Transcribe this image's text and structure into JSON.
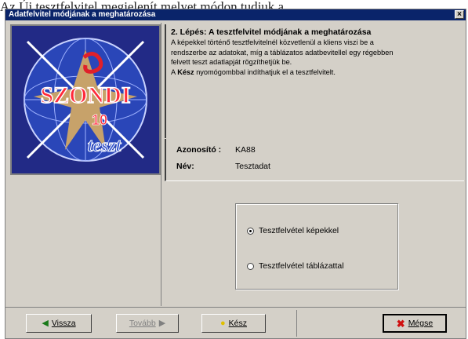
{
  "background_doc": {
    "fragment": "Az Új tesztfelvitel megjelenít melyet módon tudjuk a"
  },
  "window": {
    "title": "Adatfelvitel módjának a meghatározása",
    "close_glyph": "×"
  },
  "logo": {
    "line1": "SZONDI",
    "line2": "10",
    "line3": "teszt"
  },
  "instructions": {
    "step_title": "2. Lépés: A  tesztfelvitel módjának a meghatározása",
    "line1": "A képekkel történő tesztfelvitelnél közvetlenül a kliens viszi be a",
    "line2": "rendszerbe az adatokat, míg a táblázatos adatbevitellel egy régebben",
    "line3": "felvett teszt adatlapját rögzíthetjük be.",
    "line4_prefix": "A ",
    "line4_bold": "Kész",
    "line4_suffix": " nyomógombbal indíthatjuk el a tesztfelvitelt."
  },
  "info": {
    "id_label": "Azonosító :",
    "id_value": "KA88",
    "name_label": "Név:",
    "name_value": "Tesztadat"
  },
  "options": {
    "opt1": "Tesztfelvétel képekkel",
    "opt2": "Tesztfelvétel táblázattal",
    "selected": "opt1"
  },
  "buttons": {
    "back": "Vissza",
    "next": "Tovább",
    "done": "Kész",
    "cancel": "Mégse"
  },
  "icons": {
    "back": "arrow-left-icon",
    "next": "arrow-right-icon",
    "done": "bulb-icon",
    "cancel": "x-mark-icon"
  }
}
